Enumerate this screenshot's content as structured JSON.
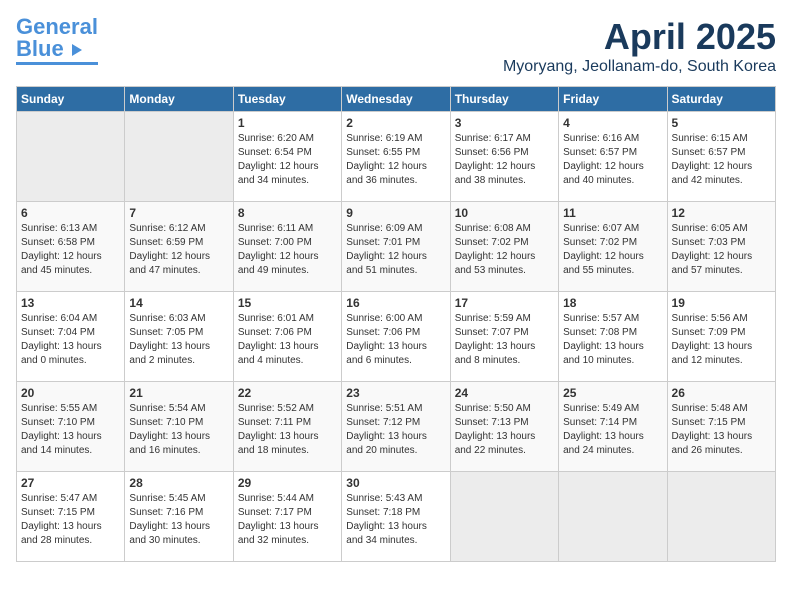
{
  "header": {
    "logo_general": "General",
    "logo_blue": "Blue",
    "title": "April 2025",
    "subtitle": "Myoryang, Jeollanam-do, South Korea"
  },
  "weekdays": [
    "Sunday",
    "Monday",
    "Tuesday",
    "Wednesday",
    "Thursday",
    "Friday",
    "Saturday"
  ],
  "weeks": [
    [
      {
        "day": "",
        "info": ""
      },
      {
        "day": "",
        "info": ""
      },
      {
        "day": "1",
        "info": "Sunrise: 6:20 AM\nSunset: 6:54 PM\nDaylight: 12 hours and 34 minutes."
      },
      {
        "day": "2",
        "info": "Sunrise: 6:19 AM\nSunset: 6:55 PM\nDaylight: 12 hours and 36 minutes."
      },
      {
        "day": "3",
        "info": "Sunrise: 6:17 AM\nSunset: 6:56 PM\nDaylight: 12 hours and 38 minutes."
      },
      {
        "day": "4",
        "info": "Sunrise: 6:16 AM\nSunset: 6:57 PM\nDaylight: 12 hours and 40 minutes."
      },
      {
        "day": "5",
        "info": "Sunrise: 6:15 AM\nSunset: 6:57 PM\nDaylight: 12 hours and 42 minutes."
      }
    ],
    [
      {
        "day": "6",
        "info": "Sunrise: 6:13 AM\nSunset: 6:58 PM\nDaylight: 12 hours and 45 minutes."
      },
      {
        "day": "7",
        "info": "Sunrise: 6:12 AM\nSunset: 6:59 PM\nDaylight: 12 hours and 47 minutes."
      },
      {
        "day": "8",
        "info": "Sunrise: 6:11 AM\nSunset: 7:00 PM\nDaylight: 12 hours and 49 minutes."
      },
      {
        "day": "9",
        "info": "Sunrise: 6:09 AM\nSunset: 7:01 PM\nDaylight: 12 hours and 51 minutes."
      },
      {
        "day": "10",
        "info": "Sunrise: 6:08 AM\nSunset: 7:02 PM\nDaylight: 12 hours and 53 minutes."
      },
      {
        "day": "11",
        "info": "Sunrise: 6:07 AM\nSunset: 7:02 PM\nDaylight: 12 hours and 55 minutes."
      },
      {
        "day": "12",
        "info": "Sunrise: 6:05 AM\nSunset: 7:03 PM\nDaylight: 12 hours and 57 minutes."
      }
    ],
    [
      {
        "day": "13",
        "info": "Sunrise: 6:04 AM\nSunset: 7:04 PM\nDaylight: 13 hours and 0 minutes."
      },
      {
        "day": "14",
        "info": "Sunrise: 6:03 AM\nSunset: 7:05 PM\nDaylight: 13 hours and 2 minutes."
      },
      {
        "day": "15",
        "info": "Sunrise: 6:01 AM\nSunset: 7:06 PM\nDaylight: 13 hours and 4 minutes."
      },
      {
        "day": "16",
        "info": "Sunrise: 6:00 AM\nSunset: 7:06 PM\nDaylight: 13 hours and 6 minutes."
      },
      {
        "day": "17",
        "info": "Sunrise: 5:59 AM\nSunset: 7:07 PM\nDaylight: 13 hours and 8 minutes."
      },
      {
        "day": "18",
        "info": "Sunrise: 5:57 AM\nSunset: 7:08 PM\nDaylight: 13 hours and 10 minutes."
      },
      {
        "day": "19",
        "info": "Sunrise: 5:56 AM\nSunset: 7:09 PM\nDaylight: 13 hours and 12 minutes."
      }
    ],
    [
      {
        "day": "20",
        "info": "Sunrise: 5:55 AM\nSunset: 7:10 PM\nDaylight: 13 hours and 14 minutes."
      },
      {
        "day": "21",
        "info": "Sunrise: 5:54 AM\nSunset: 7:10 PM\nDaylight: 13 hours and 16 minutes."
      },
      {
        "day": "22",
        "info": "Sunrise: 5:52 AM\nSunset: 7:11 PM\nDaylight: 13 hours and 18 minutes."
      },
      {
        "day": "23",
        "info": "Sunrise: 5:51 AM\nSunset: 7:12 PM\nDaylight: 13 hours and 20 minutes."
      },
      {
        "day": "24",
        "info": "Sunrise: 5:50 AM\nSunset: 7:13 PM\nDaylight: 13 hours and 22 minutes."
      },
      {
        "day": "25",
        "info": "Sunrise: 5:49 AM\nSunset: 7:14 PM\nDaylight: 13 hours and 24 minutes."
      },
      {
        "day": "26",
        "info": "Sunrise: 5:48 AM\nSunset: 7:15 PM\nDaylight: 13 hours and 26 minutes."
      }
    ],
    [
      {
        "day": "27",
        "info": "Sunrise: 5:47 AM\nSunset: 7:15 PM\nDaylight: 13 hours and 28 minutes."
      },
      {
        "day": "28",
        "info": "Sunrise: 5:45 AM\nSunset: 7:16 PM\nDaylight: 13 hours and 30 minutes."
      },
      {
        "day": "29",
        "info": "Sunrise: 5:44 AM\nSunset: 7:17 PM\nDaylight: 13 hours and 32 minutes."
      },
      {
        "day": "30",
        "info": "Sunrise: 5:43 AM\nSunset: 7:18 PM\nDaylight: 13 hours and 34 minutes."
      },
      {
        "day": "",
        "info": ""
      },
      {
        "day": "",
        "info": ""
      },
      {
        "day": "",
        "info": ""
      }
    ]
  ]
}
